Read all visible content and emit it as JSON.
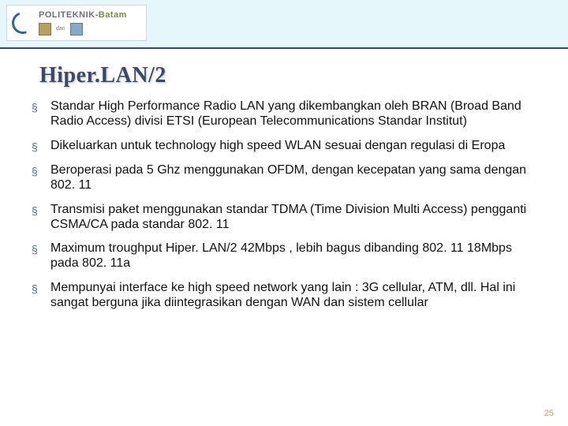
{
  "logo": {
    "brand_part1": "POLITEKNIK",
    "brand_sep": "-",
    "brand_part2": "Batam",
    "subtext": "dan"
  },
  "title": "Hiper.LAN/2",
  "bullets": [
    "Standar High Performance Radio LAN yang dikembangkan oleh BRAN (Broad Band Radio Access) divisi ETSI (European Telecommunications Standar Institut)",
    "Dikeluarkan untuk technology high speed WLAN sesuai dengan regulasi di Eropa",
    "Beroperasi pada 5 Ghz menggunakan OFDM, dengan kecepatan yang sama dengan 802. 11",
    "Transmisi paket menggunakan standar TDMA (Time Division Multi Access) pengganti CSMA/CA pada standar 802. 11",
    "Maximum troughput Hiper. LAN/2 42Mbps , lebih bagus dibanding 802. 11 18Mbps pada 802. 11a",
    "Mempunyai interface ke high speed network yang lain : 3G cellular, ATM, dll. Hal ini sangat berguna jika diintegrasikan dengan WAN dan sistem cellular"
  ],
  "page_number": "25"
}
